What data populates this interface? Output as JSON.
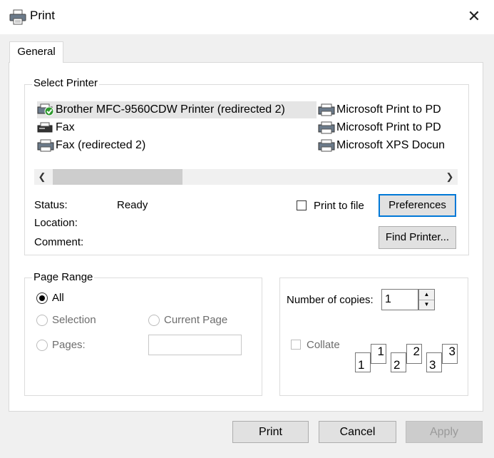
{
  "window": {
    "title": "Print",
    "close_glyph": "✕"
  },
  "tabs": [
    {
      "label": "General"
    }
  ],
  "select_printer": {
    "legend": "Select Printer",
    "printers": [
      {
        "name": "Brother MFC-9560CDW Printer (redirected 2)",
        "selected": true,
        "default": true
      },
      {
        "name": "Fax"
      },
      {
        "name": "Fax (redirected 2)"
      },
      {
        "name": "Microsoft Print to PD"
      },
      {
        "name": "Microsoft Print to PD"
      },
      {
        "name": "Microsoft XPS Docun"
      }
    ],
    "scroll_left": "❮",
    "scroll_right": "❯",
    "status_label": "Status:",
    "status_value": "Ready",
    "location_label": "Location:",
    "comment_label": "Comment:",
    "print_to_file_label": "Print to file",
    "preferences_label": "Preferences",
    "find_printer_label": "Find Printer..."
  },
  "page_range": {
    "legend": "Page Range",
    "all_label": "All",
    "selection_label": "Selection",
    "current_page_label": "Current Page",
    "pages_label": "Pages:",
    "pages_value": ""
  },
  "copies": {
    "label": "Number of copies:",
    "value": "1",
    "up_glyph": "▲",
    "down_glyph": "▼",
    "collate_label": "Collate",
    "collate_pages": [
      {
        "back": "1",
        "front": "1"
      },
      {
        "back": "2",
        "front": "2"
      },
      {
        "back": "3",
        "front": "3"
      }
    ]
  },
  "footer": {
    "print_label": "Print",
    "cancel_label": "Cancel",
    "apply_label": "Apply"
  },
  "colors": {
    "accent": "#0078d7",
    "window_bg": "#f0f0f0",
    "check_green": "#2e9a2e"
  },
  "icons": {
    "title": "printer-icon",
    "printer": "printer-icon",
    "fax": "fax-icon",
    "default": "default-check-icon"
  }
}
